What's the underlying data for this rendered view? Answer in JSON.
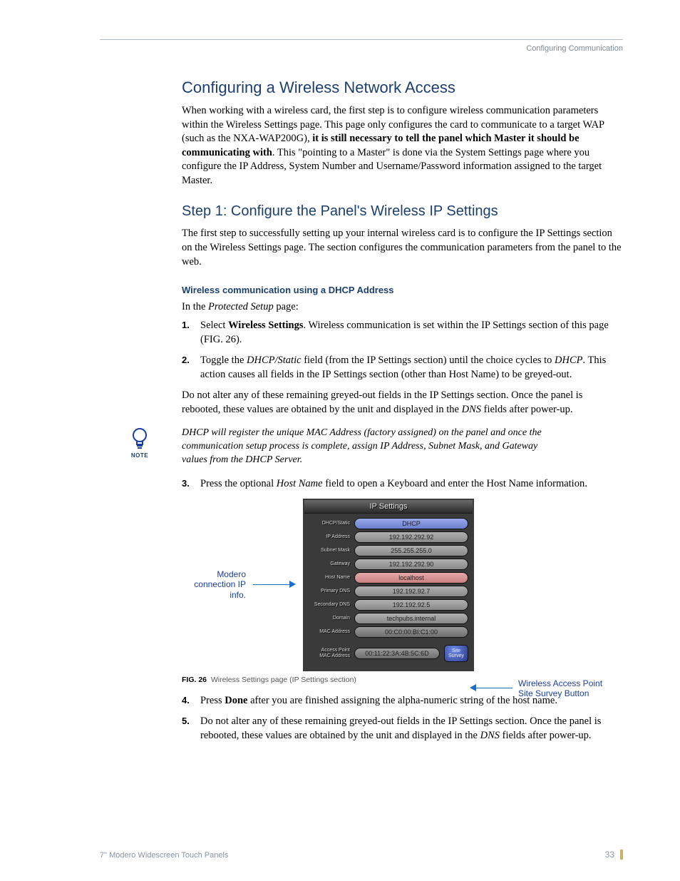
{
  "running_head": "Configuring Communication",
  "h1": "Configuring a Wireless Network Access",
  "p1_a": "When working with a wireless card, the first step is to configure wireless communication parameters within the Wireless Settings page. This page only configures the card to communicate to a target WAP (such as the NXA-WAP200G), ",
  "p1_bold": "it is still necessary to tell the panel which Master it should be communicating with",
  "p1_b": ". This \"pointing to a Master\" is done via the System Settings page where you configure the IP Address, System Number and Username/Password information assigned to the target Master.",
  "h2": "Step 1: Configure the Panel's Wireless IP Settings",
  "p2": "The first step to successfully setting up your internal wireless card is to configure the IP Settings section on the Wireless Settings page. The section configures the communication parameters from the panel to the web.",
  "h3": "Wireless communication using a DHCP Address",
  "intro_a": "In the ",
  "intro_em": "Protected Setup",
  "intro_b": " page:",
  "steps": {
    "s1_a": "Select ",
    "s1_bold": "Wireless Settings",
    "s1_b": ". Wireless communication is set within the IP Settings section of this page (FIG. 26).",
    "s2_a": "Toggle the ",
    "s2_em": "DHCP/Static",
    "s2_b": " field (from the IP Settings section) until the choice cycles to ",
    "s2_em2": "DHCP",
    "s2_c": ". This action causes all fields in the IP Settings section (other than Host Name) to be greyed-out.",
    "s3_a": "Press the optional ",
    "s3_em": "Host Name",
    "s3_b": " field to open a Keyboard and enter the Host Name information.",
    "s4_a": "Press ",
    "s4_bold": "Done",
    "s4_b": " after you are finished assigning the alpha-numeric string of the host name.",
    "s5_a": "Do not alter any of these remaining greyed-out fields in the IP Settings section. Once the panel is rebooted, these values are obtained by the unit and displayed in the ",
    "s5_em": "DNS",
    "s5_b": " fields after power-up."
  },
  "after_a": "Do not alter any of these remaining greyed-out fields in the IP Settings section. Once the panel is rebooted, these values are obtained by the unit and displayed in the ",
  "after_em": "DNS",
  "after_b": " fields after power-up.",
  "note_label": "NOTE",
  "note_text": "DHCP will register the unique MAC Address (factory assigned) on the panel and once the communication setup process is complete, assign IP Address, Subnet Mask, and Gateway values from the DHCP Server.",
  "callout_left": "Modero connection IP info.",
  "callout_right": "Wireless Access Point Site Survey Button",
  "panel": {
    "title": "IP Settings",
    "rows": [
      {
        "label": "DHCP/Static",
        "value": "DHCP",
        "style": "blue"
      },
      {
        "label": "IP Address",
        "value": "192.192.292.92",
        "style": "grey"
      },
      {
        "label": "Subnet Mask",
        "value": "255.255.255.0",
        "style": "grey"
      },
      {
        "label": "Gateway",
        "value": "192.192.292.90",
        "style": "grey"
      },
      {
        "label": "Host Name",
        "value": "localhost",
        "style": "pink"
      },
      {
        "label": "Primary DNS",
        "value": "192.192.92.7",
        "style": "grey"
      },
      {
        "label": "Secondary DNS",
        "value": "192.192.92.5",
        "style": "grey"
      },
      {
        "label": "Domain",
        "value": "techpubs.internal",
        "style": "grey"
      },
      {
        "label": "MAC Address",
        "value": "00:C0:00:BI:C1:00",
        "style": "grey-dark"
      }
    ],
    "ap_label_l1": "Access Point",
    "ap_label_l2": "MAC Address",
    "ap_value": "00:11:22:3A:4B:5C:6D",
    "survey_l1": "Site",
    "survey_l2": "Survey"
  },
  "fig_label": "FIG. 26",
  "fig_caption": "Wireless Settings page (IP Settings section)",
  "footer": "7\" Modero Widescreen Touch Panels",
  "page_num": "33"
}
